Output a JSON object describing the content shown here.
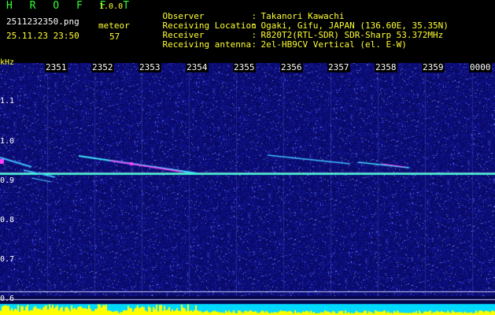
{
  "header": {
    "app_title": "H R O F F T",
    "app_version": "1.0.0",
    "filename": "2511232350.png",
    "datetime": "25.11.23 23:50",
    "type_label": "meteor",
    "count": "57",
    "info": [
      {
        "key": "Observer",
        "value": "Takanori Kawachi"
      },
      {
        "key": "Receiving Location",
        "value": "Ogaki, Gifu, JAPAN (136.60E, 35.35N)"
      },
      {
        "key": "Receiver",
        "value": "R820T2(RTL-SDR) SDR-Sharp 53.372MHz"
      },
      {
        "key": "Receiving antenna",
        "value": "2el-HB9CV Vertical (el. E-W)"
      }
    ],
    "separator": ":"
  },
  "axis": {
    "unit": "kHz",
    "time_ticks": [
      "2351",
      "2352",
      "2353",
      "2354",
      "2355",
      "2356",
      "2357",
      "2358",
      "2359",
      "0000"
    ],
    "freq_ticks": [
      "1.1",
      "1.0",
      "0.9",
      "0.8",
      "0.7",
      "0.6"
    ]
  },
  "colors": {
    "background_noise": "#0a0a78",
    "carrier": "#40ffd0",
    "meteor_echo": "#ff40ff",
    "bottom_band": "#00d8ff",
    "activity_bars": "#ffff00",
    "header_text": "#ffff33",
    "title_text": "#33ff33"
  }
}
